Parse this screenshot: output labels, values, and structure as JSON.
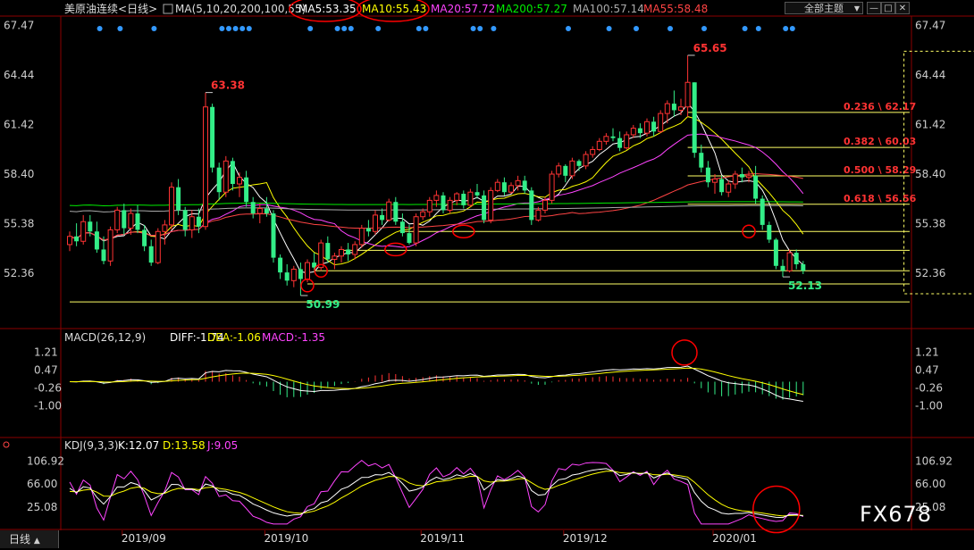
{
  "header": {
    "symbol": "美原油连续",
    "period_tag": "<日线>",
    "ma_params": "MA(5,10,20,200,100,55)",
    "ma_items": [
      {
        "label": "MA5:53.35",
        "color": "#ffffff"
      },
      {
        "label": "MA10:55.43",
        "color": "#ffff00"
      },
      {
        "label": "MA20:57.72",
        "color": "#ff44ff"
      },
      {
        "label": "MA200:57.27",
        "color": "#00ee00"
      },
      {
        "label": "MA100:57.14",
        "color": "#aaaaaa"
      },
      {
        "label": "MA55:58.48",
        "color": "#ff4444"
      }
    ],
    "theme_select": "全部主题",
    "win_min": "—",
    "win_max": "□",
    "win_close": "✕"
  },
  "bottom": {
    "period_label": "日线",
    "period_arrow": "▲"
  },
  "watermark": "FX678",
  "chart_data": {
    "type": "candlestick",
    "main_axis": {
      "ticks": [
        67.47,
        64.44,
        61.42,
        58.4,
        55.38,
        52.36
      ],
      "ylim": [
        50.5,
        67.5
      ]
    },
    "x_labels": [
      {
        "label": "2019/09",
        "index": 8
      },
      {
        "label": "2019/10",
        "index": 29
      },
      {
        "label": "2019/11",
        "index": 52
      },
      {
        "label": "2019/12",
        "index": 73
      },
      {
        "label": "2020/01",
        "index": 95
      }
    ],
    "candles": [
      [
        54.1,
        54.9,
        53.7,
        54.6
      ],
      [
        54.6,
        55.4,
        54.0,
        54.3
      ],
      [
        54.3,
        55.9,
        54.1,
        55.5
      ],
      [
        55.5,
        55.9,
        54.6,
        54.9
      ],
      [
        54.9,
        55.5,
        53.6,
        53.8
      ],
      [
        53.8,
        54.6,
        52.9,
        53.1
      ],
      [
        53.1,
        55.2,
        52.8,
        55.0
      ],
      [
        55.0,
        56.4,
        54.8,
        56.2
      ],
      [
        56.2,
        56.6,
        54.7,
        55.1
      ],
      [
        55.1,
        56.3,
        54.7,
        56.0
      ],
      [
        56.0,
        56.5,
        54.8,
        55.0
      ],
      [
        55.0,
        55.3,
        53.7,
        54.0
      ],
      [
        54.0,
        54.4,
        52.8,
        53.0
      ],
      [
        53.0,
        55.1,
        52.9,
        54.9
      ],
      [
        54.9,
        55.6,
        54.1,
        55.3
      ],
      [
        55.3,
        57.9,
        55.0,
        57.6
      ],
      [
        57.6,
        58.1,
        55.9,
        56.2
      ],
      [
        56.2,
        56.4,
        54.6,
        55.0
      ],
      [
        55.0,
        56.2,
        54.5,
        55.8
      ],
      [
        55.8,
        56.3,
        54.8,
        55.2
      ],
      [
        55.2,
        63.38,
        55.0,
        62.5
      ],
      [
        62.5,
        62.7,
        58.5,
        58.8
      ],
      [
        58.8,
        59.1,
        56.8,
        57.3
      ],
      [
        57.3,
        59.5,
        57.0,
        59.2
      ],
      [
        59.2,
        59.4,
        57.4,
        57.8
      ],
      [
        57.8,
        58.5,
        57.0,
        58.2
      ],
      [
        58.2,
        58.6,
        56.4,
        56.7
      ],
      [
        56.7,
        57.0,
        55.7,
        56.0
      ],
      [
        56.0,
        56.6,
        55.4,
        56.3
      ],
      [
        56.3,
        57.0,
        55.8,
        56.0
      ],
      [
        56.0,
        56.2,
        53.0,
        53.3
      ],
      [
        53.3,
        53.5,
        52.0,
        52.4
      ],
      [
        52.4,
        52.9,
        51.6,
        51.9
      ],
      [
        51.9,
        52.8,
        51.5,
        52.6
      ],
      [
        52.6,
        53.0,
        50.99,
        52.0
      ],
      [
        52.0,
        53.2,
        51.8,
        53.0
      ],
      [
        53.0,
        53.6,
        52.4,
        52.7
      ],
      [
        52.7,
        54.4,
        52.5,
        54.2
      ],
      [
        54.2,
        54.6,
        53.0,
        53.2
      ],
      [
        53.2,
        53.6,
        52.6,
        53.4
      ],
      [
        53.4,
        54.0,
        53.0,
        53.8
      ],
      [
        53.8,
        54.2,
        53.1,
        53.5
      ],
      [
        53.5,
        54.3,
        53.2,
        54.1
      ],
      [
        54.1,
        55.3,
        53.9,
        55.1
      ],
      [
        55.1,
        55.6,
        54.6,
        54.9
      ],
      [
        54.9,
        56.2,
        54.7,
        55.9
      ],
      [
        55.9,
        56.3,
        55.3,
        55.6
      ],
      [
        55.6,
        56.9,
        55.5,
        56.7
      ],
      [
        56.7,
        57.0,
        55.3,
        55.5
      ],
      [
        55.5,
        56.0,
        54.6,
        54.8
      ],
      [
        54.8,
        55.3,
        54.1,
        54.2
      ],
      [
        54.2,
        56.0,
        54.0,
        55.8
      ],
      [
        55.8,
        56.3,
        55.6,
        56.1
      ],
      [
        56.1,
        57.0,
        55.8,
        56.8
      ],
      [
        56.8,
        57.4,
        56.4,
        57.1
      ],
      [
        57.1,
        57.3,
        56.0,
        56.2
      ],
      [
        56.2,
        57.0,
        56.0,
        56.8
      ],
      [
        56.8,
        57.3,
        56.5,
        57.2
      ],
      [
        57.2,
        57.4,
        56.3,
        56.5
      ],
      [
        56.5,
        57.5,
        56.4,
        57.3
      ],
      [
        57.3,
        57.8,
        56.9,
        57.1
      ],
      [
        57.1,
        57.4,
        55.4,
        55.6
      ],
      [
        55.6,
        57.6,
        55.4,
        57.4
      ],
      [
        57.4,
        58.1,
        57.3,
        57.9
      ],
      [
        57.9,
        58.2,
        57.1,
        57.3
      ],
      [
        57.3,
        57.9,
        57.2,
        57.7
      ],
      [
        57.7,
        58.3,
        57.4,
        58.0
      ],
      [
        58.0,
        58.3,
        57.2,
        57.4
      ],
      [
        57.4,
        57.6,
        55.3,
        55.6
      ],
      [
        55.6,
        56.4,
        55.5,
        56.2
      ],
      [
        56.2,
        57.0,
        56.0,
        56.8
      ],
      [
        56.8,
        58.6,
        56.6,
        58.4
      ],
      [
        58.4,
        59.1,
        58.2,
        58.9
      ],
      [
        58.9,
        59.0,
        57.9,
        58.3
      ],
      [
        58.3,
        59.4,
        58.1,
        59.2
      ],
      [
        59.2,
        59.3,
        58.6,
        58.9
      ],
      [
        58.9,
        59.8,
        58.7,
        59.6
      ],
      [
        59.6,
        60.1,
        59.4,
        59.9
      ],
      [
        59.9,
        60.6,
        59.8,
        60.4
      ],
      [
        60.4,
        60.9,
        60.2,
        60.7
      ],
      [
        60.7,
        61.2,
        60.4,
        60.6
      ],
      [
        60.6,
        61.0,
        59.8,
        60.0
      ],
      [
        60.0,
        61.0,
        59.9,
        60.8
      ],
      [
        60.8,
        61.4,
        60.6,
        61.2
      ],
      [
        61.2,
        61.5,
        60.6,
        60.9
      ],
      [
        60.9,
        61.8,
        60.7,
        61.6
      ],
      [
        61.6,
        61.9,
        60.7,
        61.0
      ],
      [
        61.0,
        62.3,
        60.9,
        62.1
      ],
      [
        62.1,
        62.9,
        61.5,
        62.7
      ],
      [
        62.7,
        63.5,
        61.9,
        62.3
      ],
      [
        62.3,
        63.0,
        62.0,
        62.5
      ],
      [
        62.5,
        65.65,
        61.9,
        64.0
      ],
      [
        64.0,
        64.0,
        59.4,
        59.7
      ],
      [
        59.7,
        60.2,
        58.5,
        58.8
      ],
      [
        58.8,
        59.2,
        57.6,
        57.9
      ],
      [
        57.9,
        58.4,
        57.2,
        58.1
      ],
      [
        58.1,
        58.3,
        57.1,
        57.3
      ],
      [
        57.3,
        58.0,
        57.0,
        57.8
      ],
      [
        57.8,
        58.6,
        57.5,
        58.4
      ],
      [
        58.4,
        58.8,
        57.9,
        58.2
      ],
      [
        58.2,
        58.6,
        57.9,
        58.3
      ],
      [
        58.3,
        58.9,
        56.6,
        56.9
      ],
      [
        56.9,
        57.1,
        55.0,
        55.3
      ],
      [
        55.3,
        55.5,
        54.2,
        54.4
      ],
      [
        54.4,
        54.5,
        52.6,
        52.8
      ],
      [
        52.8,
        53.2,
        52.13,
        52.5
      ],
      [
        52.5,
        53.8,
        52.4,
        53.6
      ],
      [
        53.6,
        53.8,
        52.6,
        52.9
      ],
      [
        52.9,
        53.1,
        52.3,
        52.5
      ]
    ],
    "annotations": [
      {
        "text": "63.38",
        "index": 20,
        "price": 63.38,
        "pos": "above"
      },
      {
        "text": "50.99",
        "index": 34,
        "price": 50.99,
        "pos": "below"
      },
      {
        "text": "65.65",
        "index": 91,
        "price": 65.65,
        "pos": "above"
      },
      {
        "text": "52.13",
        "index": 105,
        "price": 52.13,
        "pos": "below"
      }
    ],
    "fib_levels": [
      {
        "label": "0.236 \\ 62.17",
        "price": 62.17
      },
      {
        "label": "0.382 \\ 60.03",
        "price": 60.03
      },
      {
        "label": "0.500 \\ 58.29",
        "price": 58.29
      },
      {
        "label": "0.618 \\ 56.56",
        "price": 56.56
      }
    ],
    "support_lines": [
      {
        "price": 54.9,
        "start_index": 49
      },
      {
        "price": 53.75,
        "start_index": 40
      },
      {
        "price": 52.5,
        "start_index": 36
      },
      {
        "price": 51.7,
        "start_index": 35
      },
      {
        "price": 50.6,
        "start_index": 0
      }
    ],
    "red_circles_main": [
      {
        "index": 35,
        "price": 51.6
      },
      {
        "index": 37,
        "price": 52.5
      },
      {
        "index": 48,
        "price": 53.8
      },
      {
        "index": 58,
        "price": 54.9
      },
      {
        "index": 100,
        "price": 54.9
      }
    ],
    "dotted_box": {
      "start_index": 106,
      "top_price": 65.9,
      "bottom_price": 51.1
    },
    "dots_row": {
      "color": "#3399ff",
      "indices": [
        1,
        4,
        9,
        19,
        20,
        21,
        22,
        23,
        32,
        36,
        37,
        38,
        42,
        48,
        49,
        56,
        57,
        59,
        70,
        76,
        80,
        85,
        90,
        96,
        98,
        102,
        103
      ]
    },
    "macd": {
      "title": "MACD(26,12,9)",
      "items": [
        {
          "label": "DIFF:-1.74",
          "color": "#ffffff"
        },
        {
          "label": "DEA:-1.06",
          "color": "#ffff00"
        },
        {
          "label": "MACD:-1.35",
          "color": "#ff44ff"
        }
      ],
      "ticks": [
        1.21,
        0.47,
        -0.26,
        -1.0
      ],
      "ylim": [
        -1.75,
        1.75
      ],
      "circle": {
        "index": 90,
        "value": 1.2
      }
    },
    "kdj": {
      "title": "KDJ(9,3,3)",
      "items": [
        {
          "label": "K:12.07",
          "color": "#ffffff"
        },
        {
          "label": "D:13.58",
          "color": "#ffff00"
        },
        {
          "label": "J:9.05",
          "color": "#ff44ff"
        }
      ],
      "ticks": [
        106.92,
        66.0,
        25.08
      ],
      "ylim": [
        -10,
        120
      ],
      "circle": {
        "index": 103,
        "value": 5
      }
    }
  }
}
